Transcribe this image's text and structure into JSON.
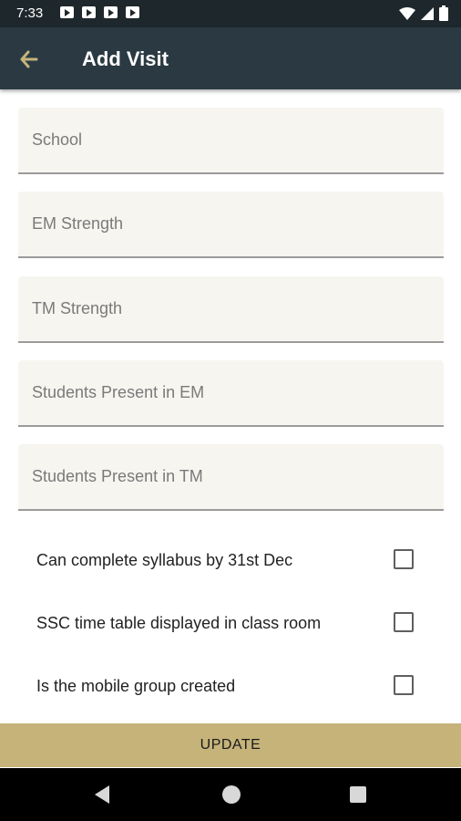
{
  "status_bar": {
    "time": "7:33",
    "notification_icons": [
      "a-icon",
      "clapperboard-icon",
      "youtube-icon",
      "youtube-icon"
    ],
    "system_icons": [
      "wifi-icon",
      "signal-icon",
      "battery-icon"
    ]
  },
  "app_bar": {
    "title": "Add Visit",
    "back_icon": "arrow-left-icon",
    "background": "#2b3a42",
    "accent": "#c5b37a"
  },
  "form": {
    "fields": [
      {
        "placeholder": "School",
        "value": ""
      },
      {
        "placeholder": "EM Strength",
        "value": ""
      },
      {
        "placeholder": "TM Strength",
        "value": ""
      },
      {
        "placeholder": "Students Present in EM",
        "value": ""
      },
      {
        "placeholder": "Students Present in TM",
        "value": ""
      }
    ],
    "checkboxes": [
      {
        "label": "Can complete syllabus by 31st Dec",
        "checked": false
      },
      {
        "label": "SSC time table displayed in class room",
        "checked": false
      },
      {
        "label": "Is the mobile group created",
        "checked": false
      }
    ]
  },
  "update_button": {
    "label": "UPDATE",
    "color": "#c5b37a"
  },
  "nav_bar": {
    "buttons": [
      "back-triangle-icon",
      "home-circle-icon",
      "recents-square-icon"
    ]
  }
}
